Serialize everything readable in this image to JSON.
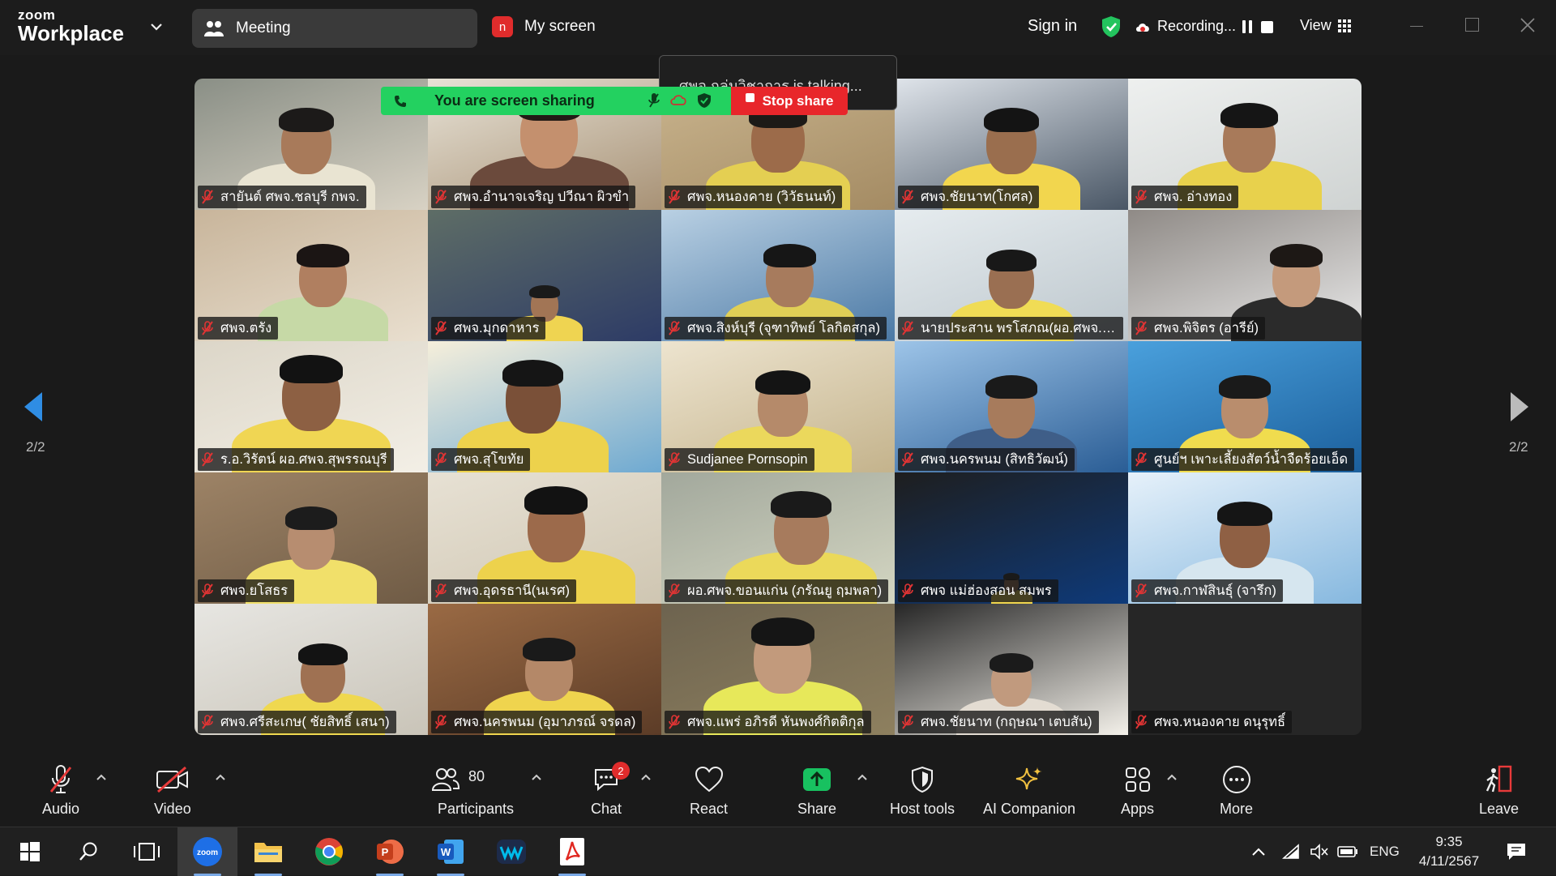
{
  "app": {
    "brand_line1": "zoom",
    "brand_line2": "Workplace",
    "meeting_tab": "Meeting",
    "my_screen_badge": "n",
    "my_screen_label": "My screen",
    "sign_in": "Sign in",
    "recording": "Recording...",
    "view": "View"
  },
  "sharing": {
    "banner": "You are screen sharing",
    "stop": "Stop share",
    "talking": "ศพจ.กลุ่มวิชาการ is talking..."
  },
  "pagination": {
    "left": "2/2",
    "right": "2/2"
  },
  "participants": [
    "สายันต์ ศพจ.ชลบุรี กพจ.",
    "ศพจ.อำนาจเจริญ ปวีณา ผิวขำ",
    "ศพจ.หนองคาย (วิวัธนนท์)",
    "ศพจ.ชัยนาท(โกศล)",
    "ศพจ. อ่างทอง",
    "ศพจ.ตรัง",
    "ศพจ.มุกดาหาร",
    "ศพจ.สิงห์บุรี (จุฑาทิพย์ โลกิตสกุล)",
    "นายประสาน พรโสภณ(ผอ.ศพจ.ลพบุรี)",
    "ศพจ.พิจิตร (อารีย์)",
    "ร.อ.วิรัตน์ ผอ.ศพจ.สุพรรณบุรี",
    "ศพจ.สุโขทัย",
    "Sudjanee Pornsopin",
    "ศพจ.นครพนม (สิทธิวัฒน์)",
    "ศูนย์ฯ เพาะเลี้ยงสัตว์น้ำจืดร้อยเอ็ด",
    "ศพจ.ยโสธร",
    "ศพจ.อุดรธานี(นเรศ)",
    "ผอ.ศพจ.ขอนแก่น (ภรัณยู ฤมพลา)",
    "ศพจ แม่ฮ่องสอน สมพร",
    "ศพจ.กาฬสินธุ์ (จารึก)",
    "ศพจ.ศรีสะเกษ( ชัยสิทธิ์ เสนา)",
    "ศพจ.นครพนม (อุมาภรณ์ จรดล)",
    "ศพจ.แพร่ อภิรดี หันพงศ์กิตติกุล",
    "ศพจ.ชัยนาท (กฤษณา เตบสัน)",
    "ศพจ.หนองคาย ดนุรุทธิ์"
  ],
  "toolbar": {
    "audio": "Audio",
    "video": "Video",
    "participants": "Participants",
    "participants_count": "80",
    "chat": "Chat",
    "chat_badge": "2",
    "react": "React",
    "share": "Share",
    "host_tools": "Host tools",
    "ai_companion": "AI Companion",
    "apps": "Apps",
    "more": "More",
    "leave": "Leave"
  },
  "taskbar": {
    "zoom_label": "zoom",
    "language": "ENG",
    "time": "9:35",
    "date": "4/11/2567"
  },
  "colors": {
    "share_green": "#23d160",
    "stop_red": "#e8262b",
    "nav_arrow": "#2f8de4",
    "share_icon_green": "#18c160"
  }
}
